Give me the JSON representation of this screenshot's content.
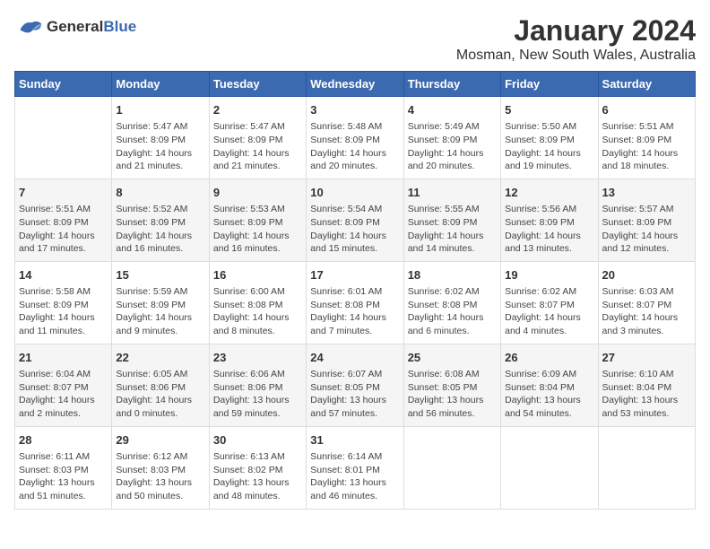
{
  "header": {
    "logo_line1": "General",
    "logo_line2": "Blue",
    "month": "January 2024",
    "location": "Mosman, New South Wales, Australia"
  },
  "days_of_week": [
    "Sunday",
    "Monday",
    "Tuesday",
    "Wednesday",
    "Thursday",
    "Friday",
    "Saturday"
  ],
  "weeks": [
    [
      {
        "day": "",
        "info": ""
      },
      {
        "day": "1",
        "info": "Sunrise: 5:47 AM\nSunset: 8:09 PM\nDaylight: 14 hours\nand 21 minutes."
      },
      {
        "day": "2",
        "info": "Sunrise: 5:47 AM\nSunset: 8:09 PM\nDaylight: 14 hours\nand 21 minutes."
      },
      {
        "day": "3",
        "info": "Sunrise: 5:48 AM\nSunset: 8:09 PM\nDaylight: 14 hours\nand 20 minutes."
      },
      {
        "day": "4",
        "info": "Sunrise: 5:49 AM\nSunset: 8:09 PM\nDaylight: 14 hours\nand 20 minutes."
      },
      {
        "day": "5",
        "info": "Sunrise: 5:50 AM\nSunset: 8:09 PM\nDaylight: 14 hours\nand 19 minutes."
      },
      {
        "day": "6",
        "info": "Sunrise: 5:51 AM\nSunset: 8:09 PM\nDaylight: 14 hours\nand 18 minutes."
      }
    ],
    [
      {
        "day": "7",
        "info": "Sunrise: 5:51 AM\nSunset: 8:09 PM\nDaylight: 14 hours\nand 17 minutes."
      },
      {
        "day": "8",
        "info": "Sunrise: 5:52 AM\nSunset: 8:09 PM\nDaylight: 14 hours\nand 16 minutes."
      },
      {
        "day": "9",
        "info": "Sunrise: 5:53 AM\nSunset: 8:09 PM\nDaylight: 14 hours\nand 16 minutes."
      },
      {
        "day": "10",
        "info": "Sunrise: 5:54 AM\nSunset: 8:09 PM\nDaylight: 14 hours\nand 15 minutes."
      },
      {
        "day": "11",
        "info": "Sunrise: 5:55 AM\nSunset: 8:09 PM\nDaylight: 14 hours\nand 14 minutes."
      },
      {
        "day": "12",
        "info": "Sunrise: 5:56 AM\nSunset: 8:09 PM\nDaylight: 14 hours\nand 13 minutes."
      },
      {
        "day": "13",
        "info": "Sunrise: 5:57 AM\nSunset: 8:09 PM\nDaylight: 14 hours\nand 12 minutes."
      }
    ],
    [
      {
        "day": "14",
        "info": "Sunrise: 5:58 AM\nSunset: 8:09 PM\nDaylight: 14 hours\nand 11 minutes."
      },
      {
        "day": "15",
        "info": "Sunrise: 5:59 AM\nSunset: 8:09 PM\nDaylight: 14 hours\nand 9 minutes."
      },
      {
        "day": "16",
        "info": "Sunrise: 6:00 AM\nSunset: 8:08 PM\nDaylight: 14 hours\nand 8 minutes."
      },
      {
        "day": "17",
        "info": "Sunrise: 6:01 AM\nSunset: 8:08 PM\nDaylight: 14 hours\nand 7 minutes."
      },
      {
        "day": "18",
        "info": "Sunrise: 6:02 AM\nSunset: 8:08 PM\nDaylight: 14 hours\nand 6 minutes."
      },
      {
        "day": "19",
        "info": "Sunrise: 6:02 AM\nSunset: 8:07 PM\nDaylight: 14 hours\nand 4 minutes."
      },
      {
        "day": "20",
        "info": "Sunrise: 6:03 AM\nSunset: 8:07 PM\nDaylight: 14 hours\nand 3 minutes."
      }
    ],
    [
      {
        "day": "21",
        "info": "Sunrise: 6:04 AM\nSunset: 8:07 PM\nDaylight: 14 hours\nand 2 minutes."
      },
      {
        "day": "22",
        "info": "Sunrise: 6:05 AM\nSunset: 8:06 PM\nDaylight: 14 hours\nand 0 minutes."
      },
      {
        "day": "23",
        "info": "Sunrise: 6:06 AM\nSunset: 8:06 PM\nDaylight: 13 hours\nand 59 minutes."
      },
      {
        "day": "24",
        "info": "Sunrise: 6:07 AM\nSunset: 8:05 PM\nDaylight: 13 hours\nand 57 minutes."
      },
      {
        "day": "25",
        "info": "Sunrise: 6:08 AM\nSunset: 8:05 PM\nDaylight: 13 hours\nand 56 minutes."
      },
      {
        "day": "26",
        "info": "Sunrise: 6:09 AM\nSunset: 8:04 PM\nDaylight: 13 hours\nand 54 minutes."
      },
      {
        "day": "27",
        "info": "Sunrise: 6:10 AM\nSunset: 8:04 PM\nDaylight: 13 hours\nand 53 minutes."
      }
    ],
    [
      {
        "day": "28",
        "info": "Sunrise: 6:11 AM\nSunset: 8:03 PM\nDaylight: 13 hours\nand 51 minutes."
      },
      {
        "day": "29",
        "info": "Sunrise: 6:12 AM\nSunset: 8:03 PM\nDaylight: 13 hours\nand 50 minutes."
      },
      {
        "day": "30",
        "info": "Sunrise: 6:13 AM\nSunset: 8:02 PM\nDaylight: 13 hours\nand 48 minutes."
      },
      {
        "day": "31",
        "info": "Sunrise: 6:14 AM\nSunset: 8:01 PM\nDaylight: 13 hours\nand 46 minutes."
      },
      {
        "day": "",
        "info": ""
      },
      {
        "day": "",
        "info": ""
      },
      {
        "day": "",
        "info": ""
      }
    ]
  ]
}
